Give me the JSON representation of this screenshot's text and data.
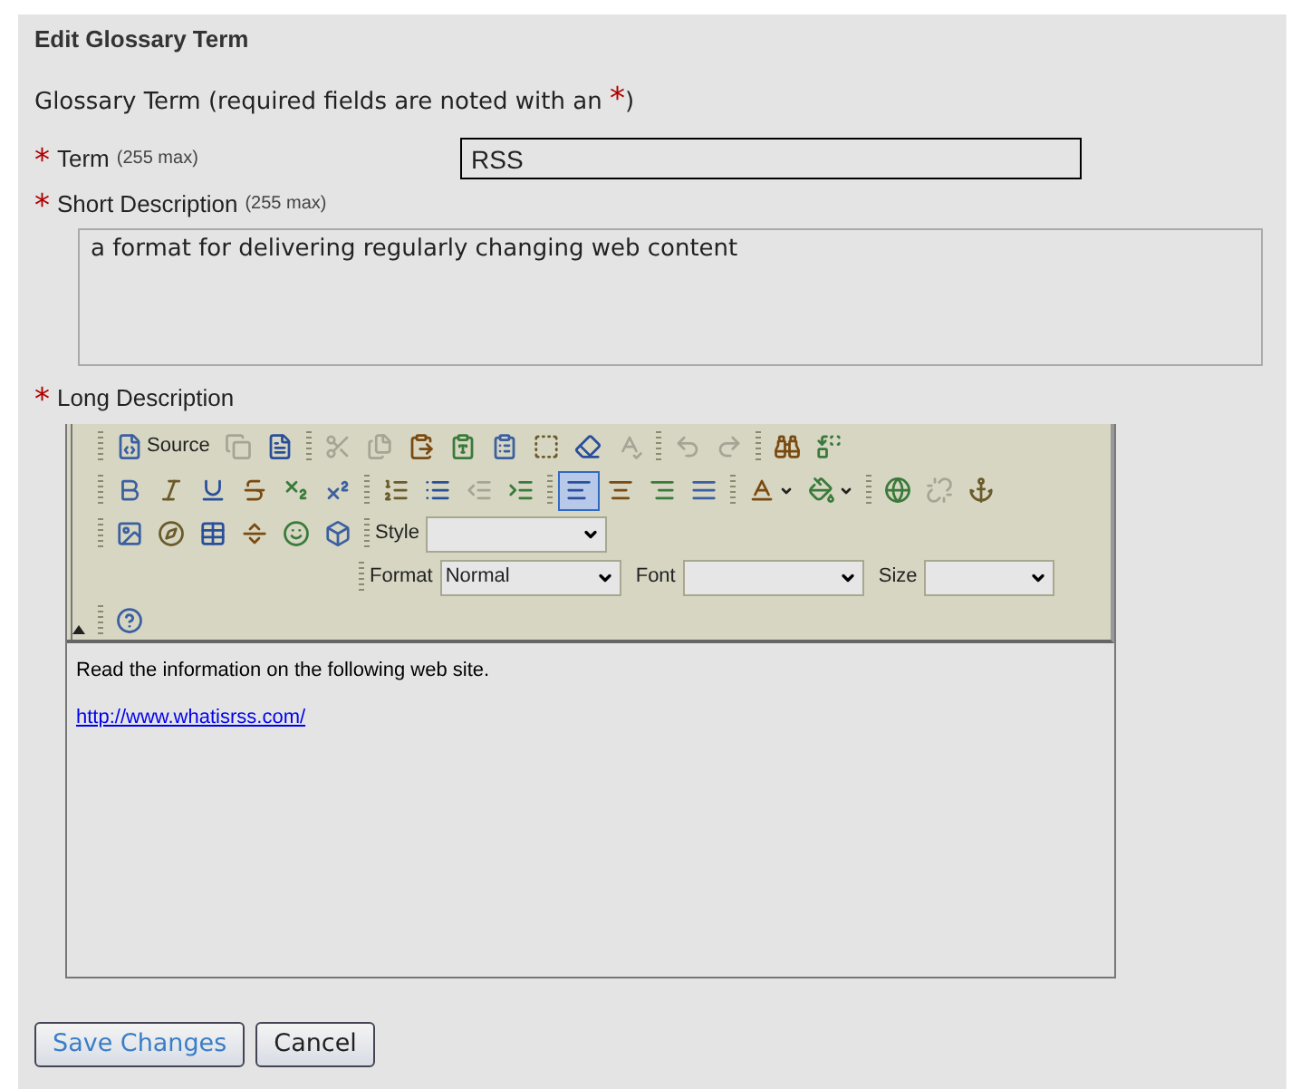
{
  "heading": "Edit Glossary Term",
  "intro": {
    "text": "Glossary Term (required fields are noted with an ",
    "mark": "*",
    "close": ")"
  },
  "term": {
    "required_mark": "*",
    "label": "Term",
    "hint": "(255 max)",
    "value": "RSS"
  },
  "short_description": {
    "required_mark": "*",
    "label": "Short Description",
    "hint": "(255 max)",
    "value": "a format for delivering regularly changing web content"
  },
  "long_description": {
    "required_mark": "*",
    "label": "Long Description"
  },
  "toolbar_rows": [
    {
      "groups": [
        [
          {
            "kind": "button",
            "label": "Source",
            "disabled": false,
            "selected": false
          },
          {
            "kind": "button",
            "disabled": true,
            "selected": false
          },
          {
            "kind": "button",
            "disabled": false,
            "selected": false
          }
        ],
        [
          {
            "kind": "button",
            "disabled": true,
            "selected": false
          },
          {
            "kind": "button",
            "disabled": true,
            "selected": false
          },
          {
            "kind": "button",
            "disabled": false,
            "selected": false
          },
          {
            "kind": "button",
            "disabled": false,
            "selected": false
          },
          {
            "kind": "button",
            "disabled": false,
            "selected": false
          },
          {
            "kind": "button",
            "disabled": false,
            "selected": false
          },
          {
            "kind": "button",
            "disabled": false,
            "selected": false
          },
          {
            "kind": "button",
            "disabled": true,
            "selected": false
          }
        ],
        [
          {
            "kind": "button",
            "disabled": true,
            "selected": false
          },
          {
            "kind": "button",
            "disabled": true,
            "selected": false
          }
        ],
        [
          {
            "kind": "button",
            "disabled": false,
            "selected": false
          },
          {
            "kind": "button",
            "disabled": false,
            "selected": false
          }
        ]
      ]
    },
    {
      "groups": [
        [
          {
            "kind": "button",
            "disabled": false,
            "selected": false
          },
          {
            "kind": "button",
            "disabled": false,
            "selected": false
          },
          {
            "kind": "button",
            "disabled": false,
            "selected": false
          },
          {
            "kind": "button",
            "disabled": false,
            "selected": false
          },
          {
            "kind": "button",
            "disabled": false,
            "selected": false
          },
          {
            "kind": "button",
            "disabled": false,
            "selected": false
          }
        ],
        [
          {
            "kind": "button",
            "disabled": false,
            "selected": false
          },
          {
            "kind": "button",
            "disabled": false,
            "selected": false
          },
          {
            "kind": "button",
            "disabled": true,
            "selected": false
          },
          {
            "kind": "button",
            "disabled": false,
            "selected": false
          }
        ],
        [
          {
            "kind": "button",
            "disabled": false,
            "selected": true
          },
          {
            "kind": "button",
            "disabled": false,
            "selected": false
          },
          {
            "kind": "button",
            "disabled": false,
            "selected": false
          },
          {
            "kind": "button",
            "disabled": false,
            "selected": false
          }
        ],
        [
          {
            "kind": "menu",
            "disabled": false,
            "selected": false
          },
          {
            "kind": "menu",
            "disabled": false,
            "selected": false
          }
        ],
        [
          {
            "kind": "button",
            "disabled": false,
            "selected": false
          },
          {
            "kind": "button",
            "disabled": true,
            "selected": false
          },
          {
            "kind": "button",
            "disabled": false,
            "selected": false
          }
        ]
      ]
    },
    {
      "groups": [
        [
          {
            "kind": "button",
            "disabled": false,
            "selected": false
          },
          {
            "kind": "button",
            "disabled": false,
            "selected": false
          },
          {
            "kind": "button",
            "disabled": false,
            "selected": false
          },
          {
            "kind": "button",
            "disabled": false,
            "selected": false
          },
          {
            "kind": "button",
            "disabled": false,
            "selected": false
          },
          {
            "kind": "button",
            "disabled": false,
            "selected": false
          }
        ],
        [
          {
            "kind": "combo",
            "label": "Style"
          }
        ]
      ]
    },
    {
      "indent": true,
      "groups": [
        [
          {
            "kind": "combo",
            "label": "Format",
            "value": "Normal"
          },
          {
            "kind": "combo",
            "label": "Font"
          },
          {
            "kind": "combo",
            "label": "Size"
          }
        ]
      ]
    },
    {
      "groups": [
        [
          {
            "kind": "button",
            "disabled": false,
            "selected": false
          }
        ]
      ]
    }
  ],
  "editor_content": {
    "paragraph": "Read the information on the following web site.",
    "link": "http://www.whatisrss.com/"
  },
  "buttons": [
    {
      "label": "Save Changes",
      "primary": true
    },
    {
      "label": "Cancel",
      "primary": false
    }
  ]
}
